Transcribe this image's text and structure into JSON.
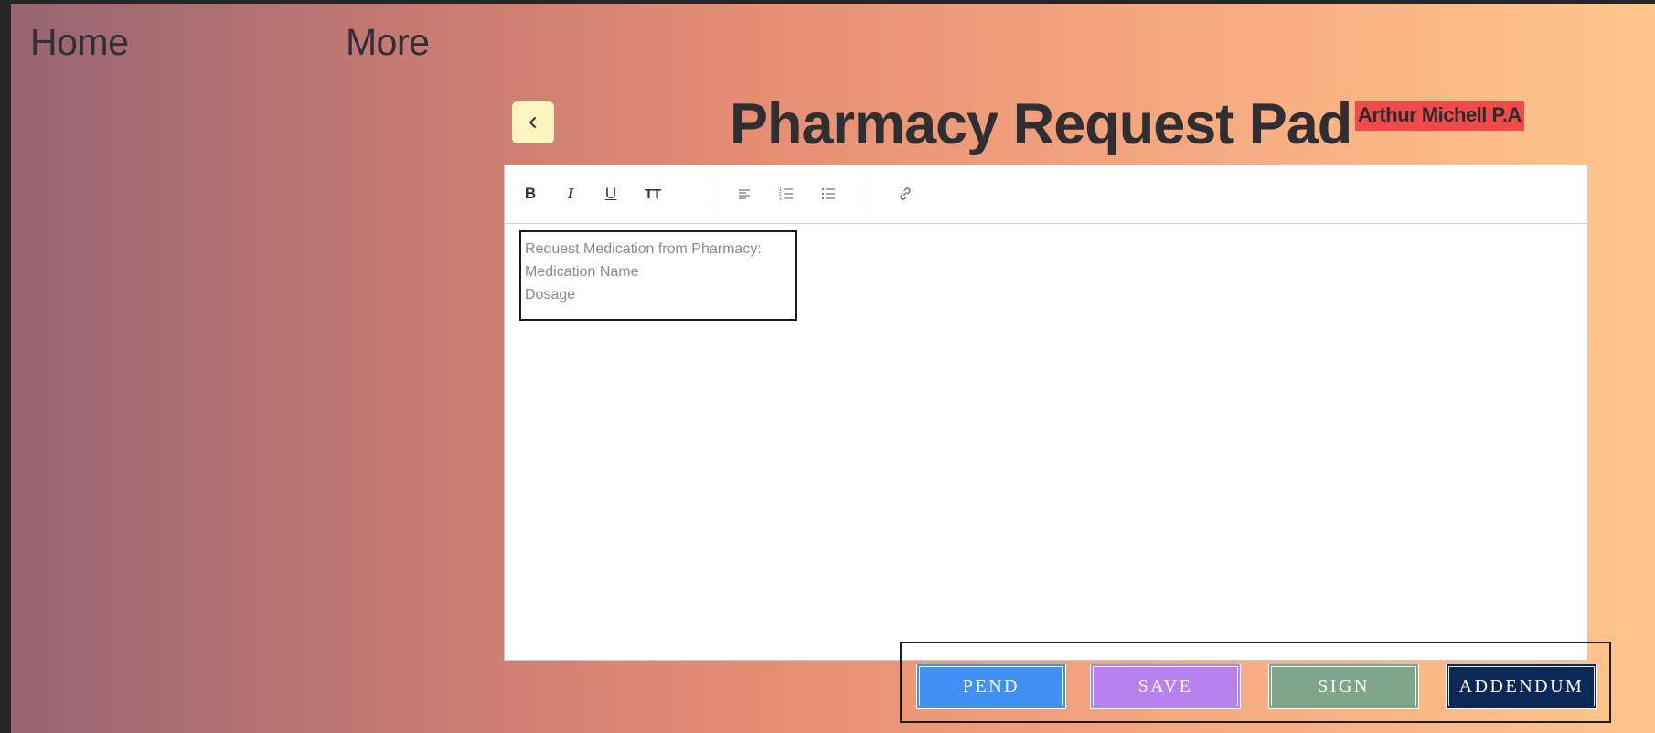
{
  "nav": {
    "home_label": "Home",
    "more_label": "More"
  },
  "header": {
    "title": "Pharmacy Request Pad",
    "badge": "Arthur Michell P.A"
  },
  "toolbar": {
    "bold": "B",
    "italic": "I",
    "underline": "U",
    "text_size": "TT",
    "icons": [
      "bold-icon",
      "italic-icon",
      "underline-icon",
      "text-size-icon",
      "align-left-icon",
      "numbered-list-icon",
      "bulleted-list-icon",
      "link-icon"
    ]
  },
  "editor": {
    "placeholder_lines": [
      "Request Medication from Pharmacy:",
      "Medication Name",
      "Dosage"
    ]
  },
  "actions": {
    "pend": "PEND",
    "save": "SAVE",
    "sign": "SIGN",
    "addendum": "ADDENDUM"
  },
  "colors": {
    "back_button_bg": "#fdf4bf",
    "badge_bg": "#f04a4a",
    "pend": "#4191f5",
    "save": "#b882ee",
    "sign": "#7fa58b",
    "addendum": "#0b2857"
  }
}
